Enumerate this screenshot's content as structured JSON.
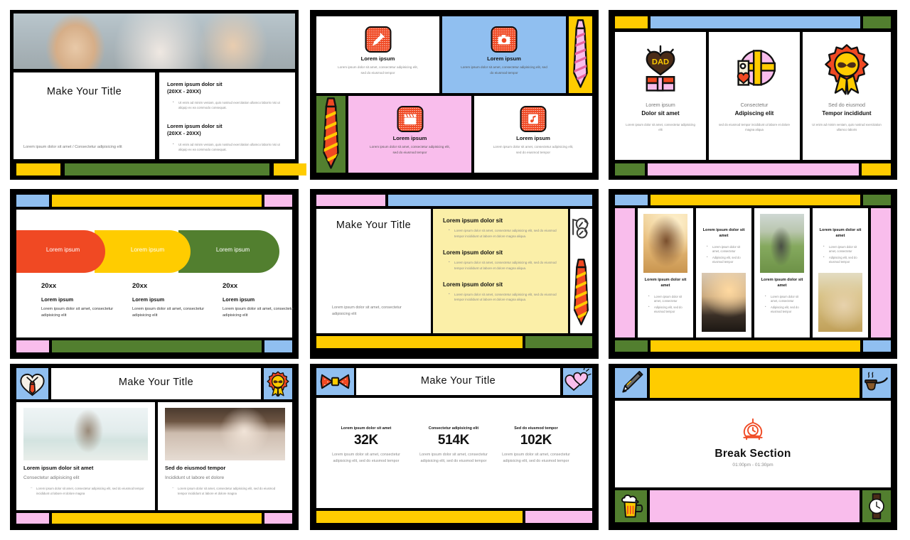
{
  "theme": {
    "black": "#000000",
    "white": "#ffffff",
    "yellow": "#FFCC00",
    "blue": "#90BFF0",
    "green": "#527F2F",
    "pink": "#F9BDEC",
    "red": "#F04923",
    "cream": "#FBEFA8"
  },
  "slides": [
    {
      "id": "title-hero",
      "title": "Make Your Title",
      "caption": "Lorem ipsum dolor sit amet /  Consectetur adipisicing elit",
      "entries": [
        {
          "heading": "Lorem ipsum dolor sit",
          "years": "(20XX - 20XX)",
          "bullet": "Ut enim ad minim veniam, quis nostrud exercitation ullamco laboris nisi ut aliquip ex ea commodo consequat."
        },
        {
          "heading": "Lorem ipsum dolor sit",
          "years": "(20XX - 20XX)",
          "bullet": "Ut enim ad minim veniam, quis nostrud exercitation ullamco laboris nisi ut aliquip ex ea commodo consequat."
        }
      ]
    },
    {
      "id": "four-icon-cards",
      "cards": [
        {
          "icon": "pen-icon",
          "title": "Lorem ipsum",
          "body": "Lorem ipsum dolor sit amet, consectetur adipisicing elit, sed do eiusmod tempor",
          "bg": "#ffffff"
        },
        {
          "icon": "camera-icon",
          "title": "Lorem ipsum",
          "body": "Lorem ipsum dolor sit amet, consectetur adipisicing elit, sed do eiusmod tempor",
          "bg": "#90BFF0"
        },
        {
          "icon": "clapperboard-icon",
          "title": "Lorem ipsum",
          "body": "Lorem ipsum dolor sit amet, consectetur adipisicing elit, sed do eiusmod tempor",
          "bg": "#F9BDEC"
        },
        {
          "icon": "music-note-icon",
          "title": "Lorem ipsum",
          "body": "Lorem ipsum dolor sit amet, consectetur adipisicing elit, sed do eiusmod tempor",
          "bg": "#ffffff"
        }
      ],
      "decor": [
        "pink-striped-tie-icon",
        "green-striped-tie-icon"
      ]
    },
    {
      "id": "three-illustration-cards",
      "cards": [
        {
          "icon": "dad-heart-gift-icon",
          "eyebrow": "Lorem ipsum",
          "title": "Dolor sit amet",
          "body": "Lorem ipsum dolor sit amet, consectetur adipisicing elit"
        },
        {
          "icon": "gift-tag-icon",
          "eyebrow": "Consectetur",
          "title": "Adipiscing elit",
          "body": "sed do eiusmod tempor incididunt ut labore et dolore magna aliqua"
        },
        {
          "icon": "mustache-badge-icon",
          "eyebrow": "Sed do eiusmod",
          "title": "Tempor incididunt",
          "body": "Ut enim ad minim veniam, quis nostrud exercitation ullamco laboris"
        }
      ]
    },
    {
      "id": "timeline-pills",
      "pills": [
        {
          "label": "Lorem ipsum",
          "color": "#F04923"
        },
        {
          "label": "Lorem ipsum",
          "color": "#FFCC00"
        },
        {
          "label": "Lorem ipsum",
          "color": "#527F2F"
        }
      ],
      "columns": [
        {
          "year": "20xx",
          "heading": "Lorem ipsum",
          "body": "Lorem ipsum dolor sit amet, consectetur adipisicing elit"
        },
        {
          "year": "20xx",
          "heading": "Lorem ipsum",
          "body": "Lorem ipsum dolor sit amet, consectetur adipisicing elit"
        },
        {
          "year": "20xx",
          "heading": "Lorem ipsum",
          "body": "Lorem ipsum dolor sit amet, consectetur adipisicing elit"
        }
      ]
    },
    {
      "id": "title-with-notes",
      "title": "Make Your Title",
      "caption": "Lorem ipsum dolor sit amet, consectetur adipisicing elit",
      "notes": [
        {
          "heading": "Lorem ipsum dolor sit",
          "bullet": "Lorem ipsum dolor sit amet, consectetur adipisicing elit, sed do eiusmod tempor incididunt ut labore et dolore magna aliqua."
        },
        {
          "heading": "Lorem ipsum dolor sit",
          "bullet": "Lorem ipsum dolor sit amet, consectetur adipisicing elit, sed do eiusmod tempor incididunt ut labore et dolore magna aliqua."
        },
        {
          "heading": "Lorem ipsum dolor sit",
          "bullet": "Lorem ipsum dolor sit amet, consectetur adipisicing elit, sed do eiusmod tempor incididunt ut labore et dolore magna aliqua."
        }
      ],
      "decor": [
        "glasses-icon",
        "striped-tie-icon"
      ]
    },
    {
      "id": "photo-gallery",
      "panels": [
        {
          "photo": "father-child-walking",
          "photo_pos": "top",
          "title": "Lorem ipsum dolor sit amet",
          "bullets": [
            "Lorem ipsum dolor sit amet, consectetur",
            "Adipiscing elit, sed do eiusmod tempor"
          ]
        },
        {
          "photo": "father-lifting-child-silhouette",
          "photo_pos": "bottom",
          "title": "Lorem ipsum dolor sit amet",
          "bullets": [
            "Lorem ipsum dolor sit amet, consectetur",
            "Adipiscing elit, sed do eiusmod tempor"
          ]
        },
        {
          "photo": "father-son-field",
          "photo_pos": "top",
          "title": "Lorem ipsum dolor sit amet",
          "bullets": [
            "Lorem ipsum dolor sit amet, consectetur",
            "Adipiscing elit, sed do eiusmod tempor"
          ]
        },
        {
          "photo": "family-wheat-field",
          "photo_pos": "bottom",
          "title": "Lorem ipsum dolor sit amet",
          "bullets": [
            "Lorem ipsum dolor sit amet, consectetur",
            "Adipiscing elit, sed do eiusmod tempor"
          ]
        }
      ]
    },
    {
      "id": "two-photo-columns",
      "title": "Make Your Title",
      "left_icon": "shirt-tie-heart-icon",
      "right_icon": "mustache-badge-icon",
      "columns": [
        {
          "photo": "father-lifting-child-beach",
          "title": "Lorem ipsum dolor sit amet",
          "subtitle": "Consectetur adipisicing  elit",
          "bullet": "Lorem ipsum dolor sit amet, consectetur adipisicing elit, sed do eiusmod tempor incididunt ut labore et dolore magna"
        },
        {
          "photo": "father-daughter-mustache",
          "title": "Sed do eiusmod tempor",
          "subtitle": "Incididunt ut labore et dolore",
          "bullet": "Lorem ipsum dolor sit amet, consectetur adipisicing elit, sed do eiusmod tempor incididunt ut labore et dolore magna"
        }
      ]
    },
    {
      "id": "kpi-stats",
      "title": "Make Your Title",
      "left_icon": "bow-tie-icon",
      "right_icon": "hearts-icon",
      "stats": [
        {
          "label": "Lorem ipsum dolor sit amet",
          "value": "32K",
          "body": "Lorem ipsum dolor sit amet, consectetur adipisicing elit, sed do eiusmod tempor"
        },
        {
          "label": "Consectetur adipisicing elit",
          "value": "514K",
          "body": "Lorem ipsum dolor sit amet, consectetur adipisicing elit, sed do eiusmod tempor"
        },
        {
          "label": "Sed do eiusmod tempor",
          "value": "102K",
          "body": "Lorem ipsum dolor sit amet, consectetur adipisicing elit, sed do eiusmod tempor"
        }
      ]
    },
    {
      "id": "break-section",
      "title": "Break Section",
      "time": "01:00pm - 01:30pm",
      "center_icon": "alarm-clock-icon",
      "corner_icons": [
        "pen-icon",
        "pipe-icon",
        "beer-mug-icon",
        "wristwatch-icon"
      ]
    }
  ]
}
